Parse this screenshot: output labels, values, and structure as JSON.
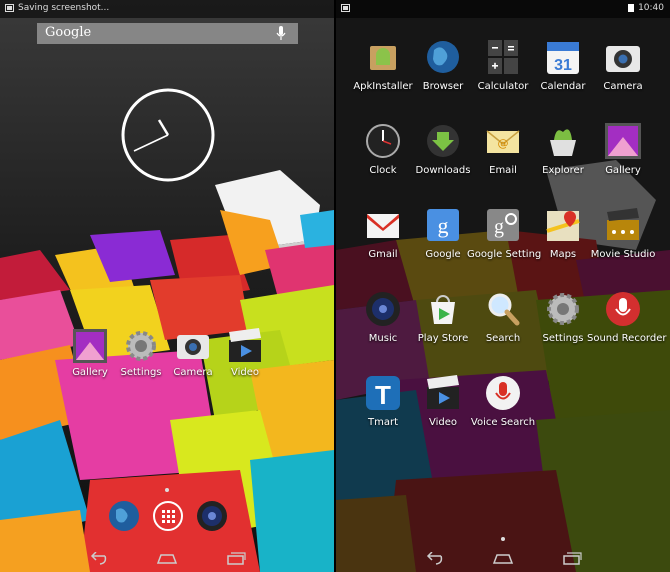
{
  "left_screen": {
    "status_text": "Saving screenshot...",
    "search_brand": "Google",
    "home_apps": [
      {
        "label": "Gallery",
        "icon": "gallery-icon"
      },
      {
        "label": "Settings",
        "icon": "gear-icon"
      },
      {
        "label": "Camera",
        "icon": "camera-icon"
      },
      {
        "label": "Video",
        "icon": "clapperboard-icon"
      }
    ],
    "dock": [
      {
        "icon": "browser-globe-icon"
      },
      {
        "icon": "all-apps-grid-icon"
      },
      {
        "icon": "music-speaker-icon"
      }
    ]
  },
  "right_screen": {
    "time": "10:40",
    "apps": [
      {
        "label": "ApkInstaller",
        "icon": "apk-installer-icon"
      },
      {
        "label": "Browser",
        "icon": "browser-globe-icon"
      },
      {
        "label": "Calculator",
        "icon": "calculator-icon"
      },
      {
        "label": "Calendar",
        "icon": "calendar-icon",
        "badge": "31"
      },
      {
        "label": "Camera",
        "icon": "camera-icon"
      },
      {
        "label": "Clock",
        "icon": "clock-icon"
      },
      {
        "label": "Downloads",
        "icon": "download-icon"
      },
      {
        "label": "Email",
        "icon": "email-icon"
      },
      {
        "label": "Explorer",
        "icon": "explorer-icon"
      },
      {
        "label": "Gallery",
        "icon": "gallery-icon"
      },
      {
        "label": "Gmail",
        "icon": "gmail-icon"
      },
      {
        "label": "Google",
        "icon": "google-search-icon"
      },
      {
        "label": "Google Setting",
        "icon": "google-settings-icon"
      },
      {
        "label": "Maps",
        "icon": "maps-icon"
      },
      {
        "label": "Movie Studio",
        "icon": "movie-studio-icon"
      },
      {
        "label": "Music",
        "icon": "music-speaker-icon"
      },
      {
        "label": "Play Store",
        "icon": "play-store-icon"
      },
      {
        "label": "Search",
        "icon": "search-icon"
      },
      {
        "label": "Settings",
        "icon": "gear-icon"
      },
      {
        "label": "Sound Recorder",
        "icon": "sound-recorder-icon"
      },
      {
        "label": "Tmart",
        "icon": "tmart-icon"
      },
      {
        "label": "Video",
        "icon": "clapperboard-icon"
      },
      {
        "label": "Voice Search",
        "icon": "voice-search-icon"
      }
    ]
  },
  "colors": {
    "searchbar": "#c8c8c8",
    "gmail_red": "#d93025",
    "google_blue": "#4a90e2",
    "tmart_blue": "#1e6fb8",
    "recorder_red": "#d32f2f"
  }
}
